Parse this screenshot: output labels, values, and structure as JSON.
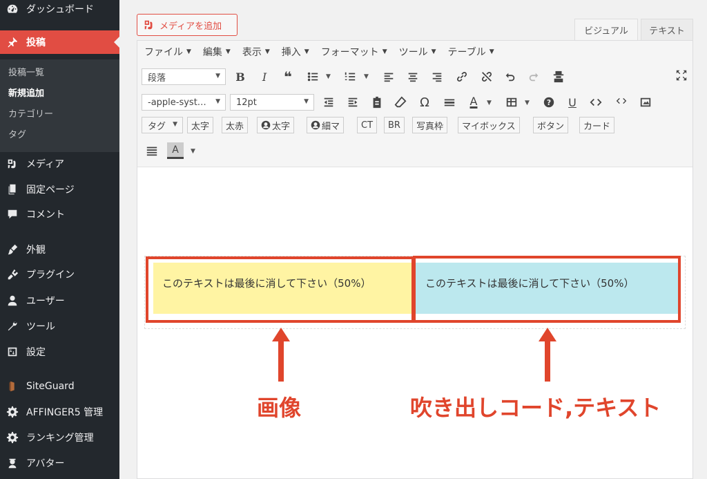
{
  "sidebar": {
    "dashboard": "ダッシュボード",
    "posts": "投稿",
    "sub": [
      "投稿一覧",
      "新規追加",
      "カテゴリー",
      "タグ"
    ],
    "media": "メディア",
    "pages": "固定ページ",
    "comments": "コメント",
    "appearance": "外観",
    "plugins": "プラグイン",
    "users": "ユーザー",
    "tools": "ツール",
    "settings": "設定",
    "siteguard": "SiteGuard",
    "affinger": "AFFINGER5 管理",
    "ranking": "ランキング管理",
    "avatar": "アバター"
  },
  "editor": {
    "add_media": "メディアを追加",
    "tab_visual": "ビジュアル",
    "tab_text": "テキスト",
    "menubar": [
      "ファイル",
      "編集",
      "表示",
      "挿入",
      "フォーマット",
      "ツール",
      "テーブル"
    ],
    "format_select": "段落",
    "font_select": "-apple-syst…",
    "size_select": "12pt",
    "tag_select": "タグ",
    "chips": [
      "太字",
      "太赤",
      "太字",
      "細マ",
      "CT",
      "BR",
      "写真枠",
      "マイボックス",
      "ボタン",
      "カード"
    ],
    "bold": "B",
    "italic": "I",
    "quote": "❝",
    "omega": "Ω",
    "text_color": "A",
    "underline": "U",
    "help": "?",
    "bg_color": "A"
  },
  "content": {
    "left_text": "このテキストは最後に消して下さい（50%）",
    "right_text": "このテキストは最後に消して下さい（50%）"
  },
  "annotations": {
    "left_label": "画像",
    "right_label": "吹き出しコード,テキスト"
  },
  "colors": {
    "sidebar_bg": "#23282d",
    "active_bg": "#e14d43",
    "annotation": "#e0452c",
    "yellow_col": "#fff4a3",
    "blue_col": "#bce8ee"
  }
}
